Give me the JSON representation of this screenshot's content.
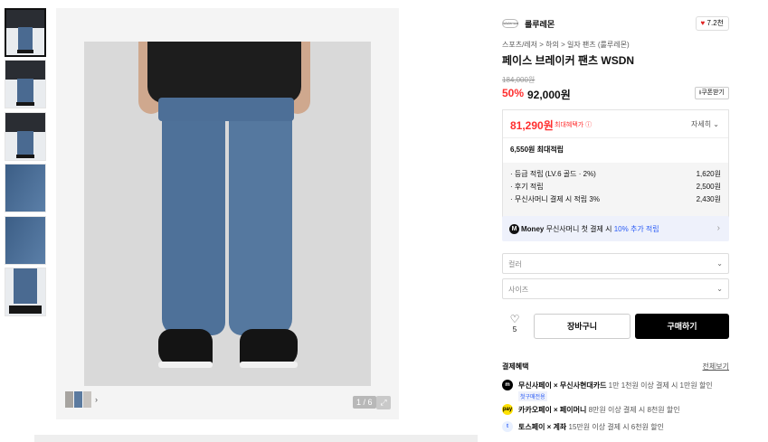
{
  "gallery": {
    "thumbnails": [
      {
        "name": "thumbnail-1",
        "kind": "full"
      },
      {
        "name": "thumbnail-2",
        "kind": "full"
      },
      {
        "name": "thumbnail-3",
        "kind": "full"
      },
      {
        "name": "thumbnail-4",
        "kind": "detail"
      },
      {
        "name": "thumbnail-5",
        "kind": "detail"
      },
      {
        "name": "thumbnail-6",
        "kind": "legs"
      }
    ],
    "page_indicator": "1 / 6",
    "expand_icon": "expand-icon",
    "swatch_chevron": "›"
  },
  "product": {
    "brand": "룰루레몬",
    "brand_logo_text": "lululemon",
    "likes": "7.2천",
    "breadcrumb": "스포츠/레저 > 하의 > 일자 팬츠 (룰루레몬)",
    "title": "페이스 브레이커 팬츠 WSDN",
    "original_price": "184,000원",
    "discount": "50%",
    "price": "92,000원",
    "coupon_label": "쿠폰받기"
  },
  "benefit": {
    "max_price": "81,290원",
    "max_label": "최대혜택가",
    "detail_label": "자세히",
    "max_points": "6,550원 최대적립",
    "lines": [
      {
        "label": "· 등급 적립 (LV.6 골드 · 2%)",
        "value": "1,620원"
      },
      {
        "label": "· 후기 적립",
        "value": "2,500원"
      },
      {
        "label": "· 무신사머니 결제 시 적립 3%",
        "value": "2,430원"
      }
    ]
  },
  "money_bar": {
    "badge": "M",
    "brand": "Money",
    "text": "무신사머니 첫 결제 시",
    "highlight": "10% 추가 적립"
  },
  "options": {
    "color_placeholder": "컬러",
    "size_placeholder": "사이즈"
  },
  "actions": {
    "wish_count": "5",
    "cart_label": "장바구니",
    "buy_label": "구매하기"
  },
  "payment": {
    "heading": "결제혜택",
    "see_all": "전체보기",
    "items": [
      {
        "bold": "무신사페이 × 무신사현대카드",
        "text": " 1만 1천원 이상 결제 시 1만원 할인",
        "tag": "첫구매전용"
      },
      {
        "bold": "카카오페이 × 페이머니",
        "text": " 8만원 이상 결제 시 8천원 할인"
      },
      {
        "bold": "토스페이 × 계좌",
        "text": " 15만원 이상 결제 시 6천원 할인"
      }
    ]
  },
  "colors": {
    "accent_red": "#ff2e2e",
    "accent_blue": "#2b5cf6",
    "buy_button": "#000000"
  }
}
